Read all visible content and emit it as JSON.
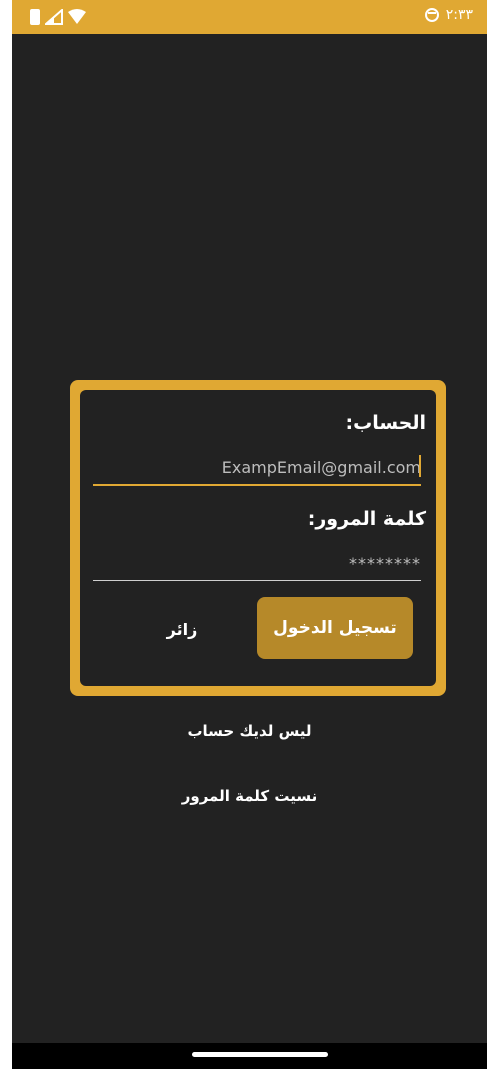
{
  "status_bar": {
    "time": "٢:٣٣",
    "icons": [
      "battery-icon",
      "signal-icon",
      "wifi-icon",
      "clock-icon"
    ],
    "color": "#e0a833"
  },
  "login_card": {
    "account_label": "الحساب:",
    "email_value": "ExampEmail@gmail.com",
    "password_label": "كلمة المرور:",
    "password_placeholder": "********",
    "login_button": "تسجيل الدخول",
    "guest_button": "زائر"
  },
  "links": {
    "no_account": "ليس لديك حساب",
    "forgot_password": "نسيت كلمة المرور"
  },
  "colors": {
    "accent": "#e0a833",
    "button": "#b68929",
    "background": "#222222"
  }
}
